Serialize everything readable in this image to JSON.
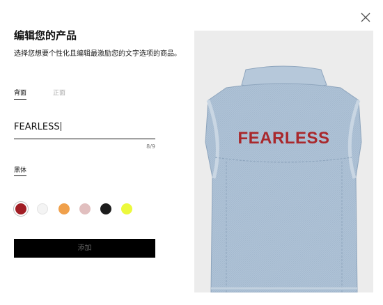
{
  "dialog": {
    "close_icon": "close-icon",
    "title": "编辑您的产品",
    "subtitle": "选择您想要个性化且编辑最激励您的文字选项的商品。"
  },
  "tabs": [
    {
      "label": "背面",
      "active": true
    },
    {
      "label": "正面",
      "active": false
    }
  ],
  "text_input": {
    "value": "FEARLESS",
    "count": "8/9"
  },
  "font": {
    "label": "黑体"
  },
  "colors": {
    "selected": "#a11d24",
    "swatches": [
      "#a11d24",
      "#f4f4f4",
      "#f0a04b",
      "#e1bfbf",
      "#1c1c1c",
      "#ecf93c"
    ]
  },
  "add_button": {
    "label": "添加"
  },
  "preview": {
    "print_text": "FEARLESS",
    "print_color": "#a9282c",
    "garment_color": "#aec2d6"
  }
}
